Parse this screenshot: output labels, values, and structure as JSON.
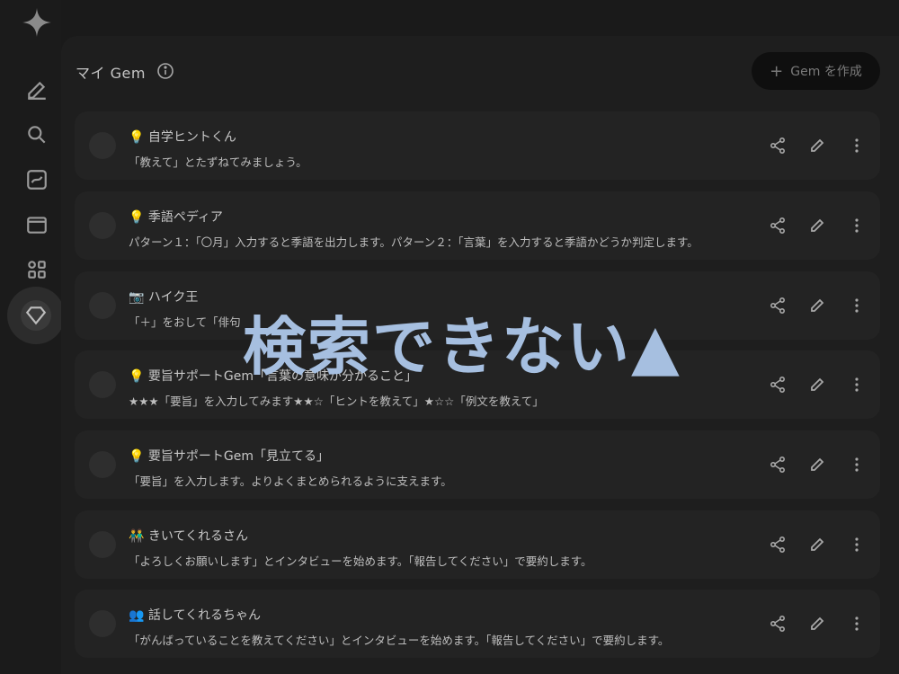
{
  "header": {
    "title": "マイ Gem",
    "new_gem_label": "Gem を作成"
  },
  "rail": {
    "items": [
      "pencil-icon",
      "search-icon",
      "explore-icon",
      "folder-icon",
      "apps-icon",
      "gem-icon"
    ]
  },
  "gems": [
    {
      "title": "💡 自学ヒントくん",
      "desc": "「教えて」とたずねてみましょう。"
    },
    {
      "title": "💡 季語ペディア",
      "desc": "パターン１：「〇月」入力すると季語を出力します。パターン２：「言葉」を入力すると季語かどうか判定します。"
    },
    {
      "title": "📷 ハイク王",
      "desc": "「＋」をおして「俳句"
    },
    {
      "title": "💡 要旨サポートGem「言葉の意味が分かること」",
      "desc": "★★★「要旨」を入力してみます★★☆「ヒントを教えて」★☆☆「例文を教えて」"
    },
    {
      "title": "💡 要旨サポートGem「見立てる」",
      "desc": "「要旨」を入力します。よりよくまとめられるように支えます。"
    },
    {
      "title": "👬 きいてくれるさん",
      "desc": "「よろしくお願いします」とインタビューを始めます。「報告してください」で要約します。"
    },
    {
      "title": "👥 話してくれるちゃん",
      "desc": "「がんばっていることを教えてください」とインタビューを始めます。「報告してください」で要約します。"
    }
  ],
  "overlay": {
    "text": "検索できない▲"
  },
  "colors": {
    "background": "#1a1a1a",
    "card": "#232323",
    "overlay_text": "#a6bfe0"
  }
}
